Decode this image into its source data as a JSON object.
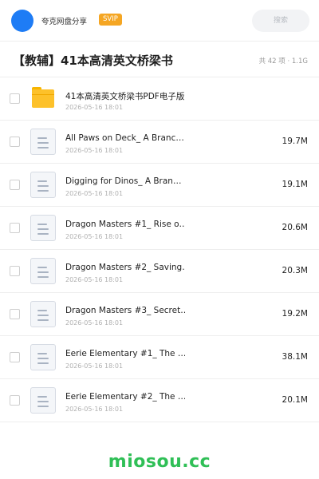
{
  "header": {
    "app_name": "夸克网盘分享",
    "badge": "SVIP",
    "search_placeholder": "搜索",
    "accent_color": "#1e7cf5",
    "badge_color": "#f5a623"
  },
  "folder": {
    "title": "【教辅】41本高清英文桥梁书",
    "meta": "共 42 项 · 1.1G"
  },
  "files": [
    {
      "name": "41本高清英文桥梁书PDF电子版",
      "date": "2026-05-16 18:01",
      "size": "",
      "icon": "folder-icon"
    },
    {
      "name": "All Paws on Deck_ A Branc…",
      "date": "2026-05-16 18:01",
      "size": "19.7M",
      "icon": "document-icon"
    },
    {
      "name": "Digging for Dinos_ A Bran…",
      "date": "2026-05-16 18:01",
      "size": "19.1M",
      "icon": "document-icon"
    },
    {
      "name": "Dragon Masters #1_ Rise o…",
      "date": "2026-05-16 18:01",
      "size": "20.6M",
      "icon": "document-icon"
    },
    {
      "name": "Dragon Masters #2_ Saving…",
      "date": "2026-05-16 18:01",
      "size": "20.3M",
      "icon": "document-icon"
    },
    {
      "name": "Dragon Masters #3_ Secret…",
      "date": "2026-05-16 18:01",
      "size": "19.2M",
      "icon": "document-icon"
    },
    {
      "name": "Eerie Elementary #1_ The …",
      "date": "2026-05-16 18:01",
      "size": "38.1M",
      "icon": "document-icon"
    },
    {
      "name": "Eerie Elementary #2_ The …",
      "date": "2026-05-16 18:01",
      "size": "20.1M",
      "icon": "document-icon"
    }
  ],
  "watermark": "miosou.cc"
}
